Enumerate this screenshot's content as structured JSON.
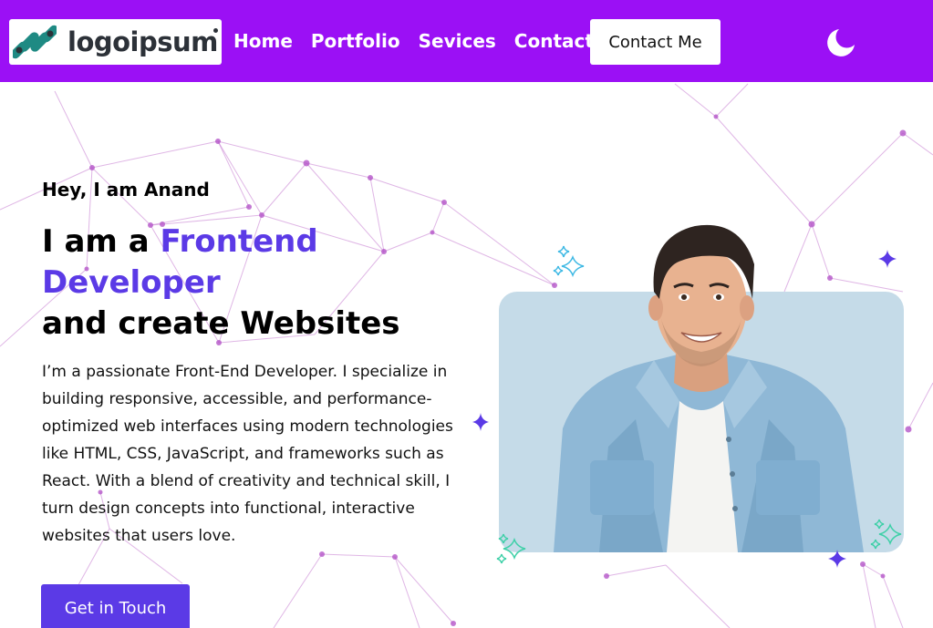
{
  "logo": {
    "text": "logoipsum"
  },
  "nav": {
    "items": [
      {
        "label": "Home"
      },
      {
        "label": "Portfolio"
      },
      {
        "label": "Sevices"
      },
      {
        "label": "Contacts"
      }
    ],
    "contact_button": "Contact Me",
    "theme_icon": "moon-icon"
  },
  "hero": {
    "greeting": "Hey, I am Anand",
    "headline_prefix": "I am a ",
    "headline_accent": "Frontend Developer",
    "headline_suffix": "and create Websites",
    "bio": "I’m a passionate Front-End Developer. I specialize in building responsive, accessible, and performance-optimized web interfaces using modern technologies like HTML, CSS, JavaScript, and frameworks such as React. With a blend of creativity and technical skill, I turn design concepts into functional, interactive websites that users love.",
    "cta": "Get in Touch"
  },
  "colors": {
    "nav_bg": "#9b10f5",
    "accent": "#5b3ae6",
    "network": "#b455c8",
    "portrait_bg": "#c5dbe8"
  }
}
